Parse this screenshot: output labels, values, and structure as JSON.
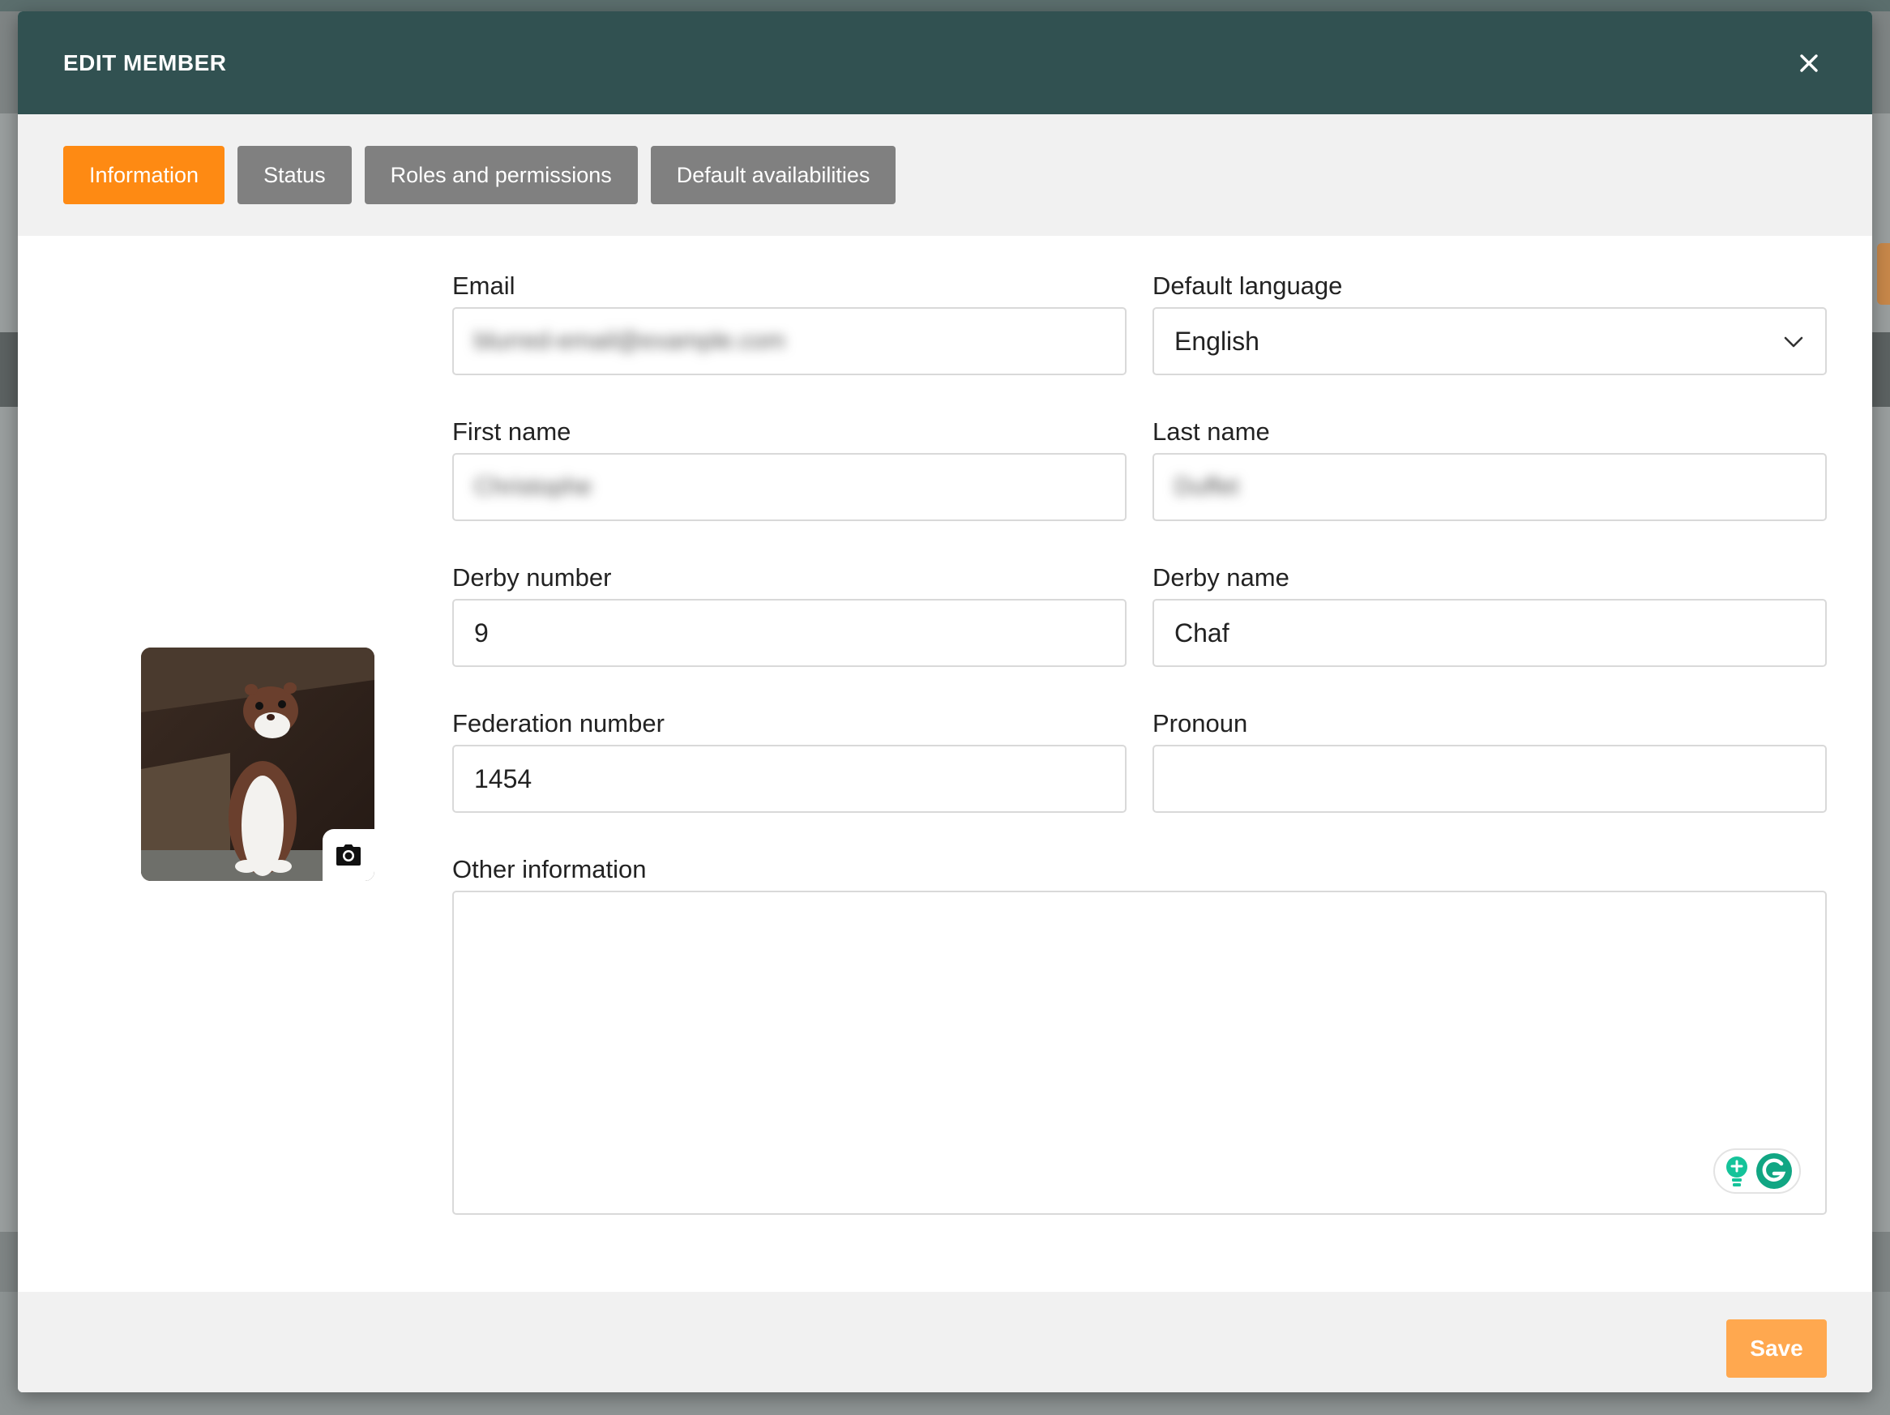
{
  "modal": {
    "title": "EDIT MEMBER",
    "close_icon": "close-icon"
  },
  "tabs": [
    {
      "label": "Information",
      "active": true
    },
    {
      "label": "Status",
      "active": false
    },
    {
      "label": "Roles and permissions",
      "active": false
    },
    {
      "label": "Default availabilities",
      "active": false
    }
  ],
  "avatar": {
    "camera_icon": "camera-icon"
  },
  "form": {
    "email": {
      "label": "Email",
      "value": "blurred-email@example.com"
    },
    "default_language": {
      "label": "Default language",
      "value": "English"
    },
    "first_name": {
      "label": "First name",
      "value": "Christophe"
    },
    "last_name": {
      "label": "Last name",
      "value": "Duffet"
    },
    "derby_number": {
      "label": "Derby number",
      "value": "9"
    },
    "derby_name": {
      "label": "Derby name",
      "value": "Chaf"
    },
    "federation_number": {
      "label": "Federation number",
      "value": "1454"
    },
    "pronoun": {
      "label": "Pronoun",
      "value": ""
    },
    "other_information": {
      "label": "Other information",
      "value": ""
    }
  },
  "footer": {
    "save_label": "Save"
  },
  "colors": {
    "header_bg": "#315151",
    "tab_active": "#fe8a13",
    "tab_inactive": "#808080",
    "save_button": "#ffa84f",
    "grammarly": "#15c39a"
  }
}
